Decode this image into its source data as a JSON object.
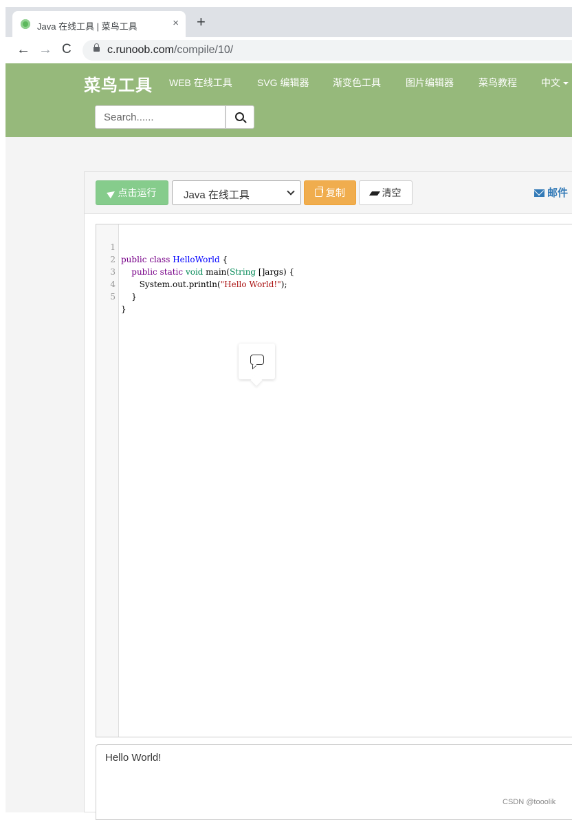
{
  "browser": {
    "tab_title": "Java 在线工具 | 菜鸟工具",
    "tab_close": "×",
    "new_tab": "+",
    "url_host": "c.runoob.com",
    "url_path": "/compile/10/"
  },
  "site": {
    "logo": "菜鸟工具",
    "nav": [
      {
        "label": "WEB 在线工具"
      },
      {
        "label": "SVG 编辑器"
      },
      {
        "label": "渐变色工具"
      },
      {
        "label": "图片编辑器"
      },
      {
        "label": "菜鸟教程"
      },
      {
        "label": "中文"
      }
    ],
    "search": {
      "placeholder": "Search......"
    }
  },
  "toolbar": {
    "run_label": "点击运行",
    "language_selected": "Java 在线工具",
    "copy_label": "复制",
    "clear_label": "清空",
    "mail_label": "邮件"
  },
  "editor": {
    "lines": [
      {
        "num": "1",
        "code": "public class HelloWorld {"
      },
      {
        "num": "2",
        "code": "    public static void main(String []args) {"
      },
      {
        "num": "3",
        "code": "       System.out.println(\"Hello World!\");"
      },
      {
        "num": "4",
        "code": "    }"
      },
      {
        "num": "5",
        "code": "}"
      }
    ]
  },
  "output": {
    "text": "Hello World!"
  },
  "watermark": "CSDN @tooolik",
  "colors": {
    "header_bg": "#96b97b",
    "run_button": "#86cc8c",
    "copy_button": "#f0ad4e",
    "mail_link": "#337ab7"
  }
}
